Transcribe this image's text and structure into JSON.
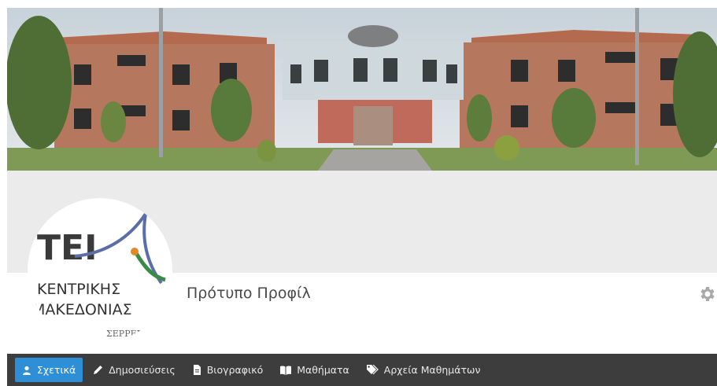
{
  "profile": {
    "name": "Πρότυπο Προφίλ"
  },
  "logo": {
    "letters": "ΤΕΙ",
    "line1": "ΚΕΝΤΡΙΚΗΣ",
    "line2": "ΜΑΚΕΔΟΝΙΑΣ",
    "line3": "ΣΕΡΡΕΣ"
  },
  "nav": {
    "items": [
      {
        "label": "Σχετικά",
        "icon": "user-icon",
        "active": true
      },
      {
        "label": "Δημοσιεύσεις",
        "icon": "pencil-icon",
        "active": false
      },
      {
        "label": "Βιογραφικό",
        "icon": "document-icon",
        "active": false
      },
      {
        "label": "Μαθήματα",
        "icon": "book-icon",
        "active": false
      },
      {
        "label": "Αρχεία Μαθημάτων",
        "icon": "tags-icon",
        "active": false
      }
    ]
  },
  "colors": {
    "nav_bg": "#3d3d3d",
    "nav_active": "#2e8fd6",
    "band": "#ebebeb"
  }
}
